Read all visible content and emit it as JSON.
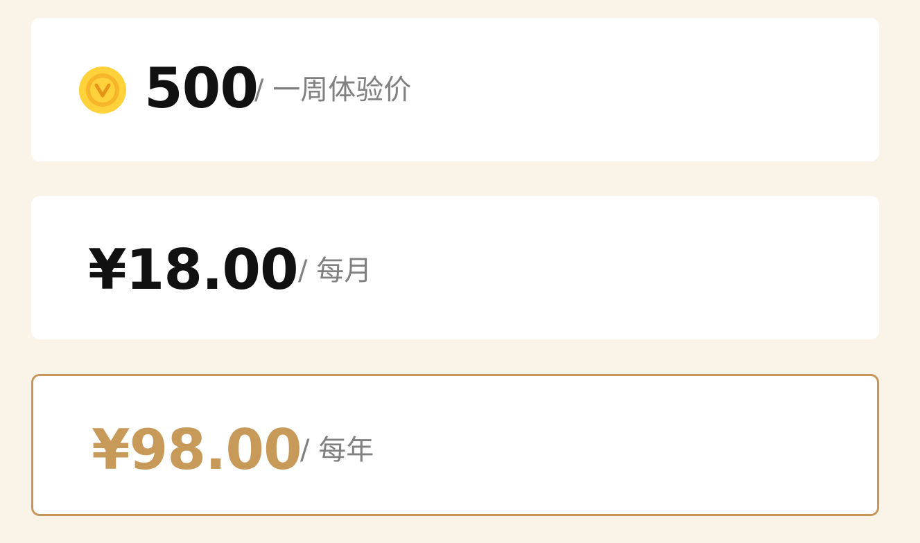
{
  "plans": [
    {
      "icon": "coin-icon",
      "price": "500",
      "period": "/ 一周体验价",
      "selected": false
    },
    {
      "price": "¥18.00",
      "period": "/ 每月",
      "selected": false
    },
    {
      "price": "¥98.00",
      "period": "/ 每年",
      "selected": true
    }
  ],
  "colors": {
    "background": "#faf3e7",
    "card": "#ffffff",
    "accent": "#c89a5a",
    "price_default": "#111111",
    "period_text": "#808080",
    "coin_outer": "#ffd23c",
    "coin_inner": "#f2a81e"
  }
}
